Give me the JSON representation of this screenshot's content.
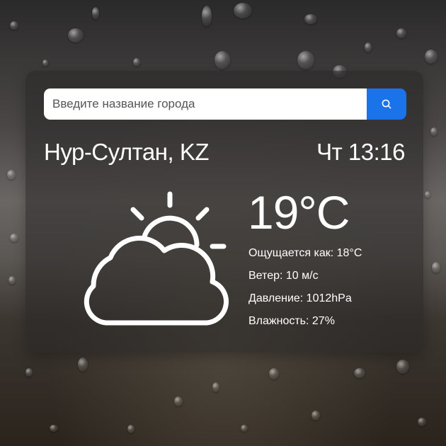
{
  "search": {
    "placeholder": "Введите название города",
    "value": ""
  },
  "location": {
    "city": "Нур-Султан, KZ",
    "datetime": "Чт 13:16"
  },
  "current": {
    "temperature": "19°C",
    "icon": "partly-cloudy-icon",
    "feels_like": "Ощущается как: 18°C",
    "wind": "Ветер: 10 м/с",
    "pressure": "Давление: 1012hPa",
    "humidity": "Влажность: 27%"
  },
  "colors": {
    "accent": "#1a73e8",
    "text": "#ffffff",
    "card": "#282626"
  }
}
